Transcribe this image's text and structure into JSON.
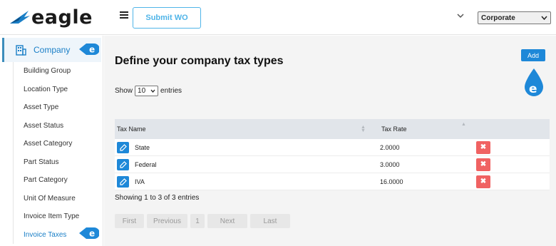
{
  "header": {
    "logo_text": "eagle",
    "submit_wo_label": "Submit WO",
    "company_select_value": "Corporate"
  },
  "sidebar": {
    "section_label": "Company",
    "items": [
      {
        "label": "Building Group"
      },
      {
        "label": "Location Type"
      },
      {
        "label": "Asset Type"
      },
      {
        "label": "Asset Status"
      },
      {
        "label": "Asset Category"
      },
      {
        "label": "Part Status"
      },
      {
        "label": "Part Category"
      },
      {
        "label": "Unit Of Measure"
      },
      {
        "label": "Invoice Item Type"
      },
      {
        "label": "Invoice Taxes"
      }
    ],
    "active_index": 9
  },
  "main": {
    "title": "Define your company tax types",
    "add_label": "Add",
    "show_label": "Show",
    "entries_label": "entries",
    "page_length": "10",
    "columns": [
      "Tax Name",
      "Tax Rate"
    ],
    "rows": [
      {
        "name": "State",
        "rate": "2.0000"
      },
      {
        "name": "Federal",
        "rate": "3.0000"
      },
      {
        "name": "IVA",
        "rate": "16.0000"
      }
    ],
    "showing_text": "Showing 1 to 3 of 3 entries",
    "pager": {
      "first": "First",
      "previous": "Previous",
      "page": "1",
      "next": "Next",
      "last": "Last"
    }
  },
  "colors": {
    "accent": "#1e88d8",
    "danger": "#f06262",
    "brand_blue": "#1a7fc7"
  }
}
